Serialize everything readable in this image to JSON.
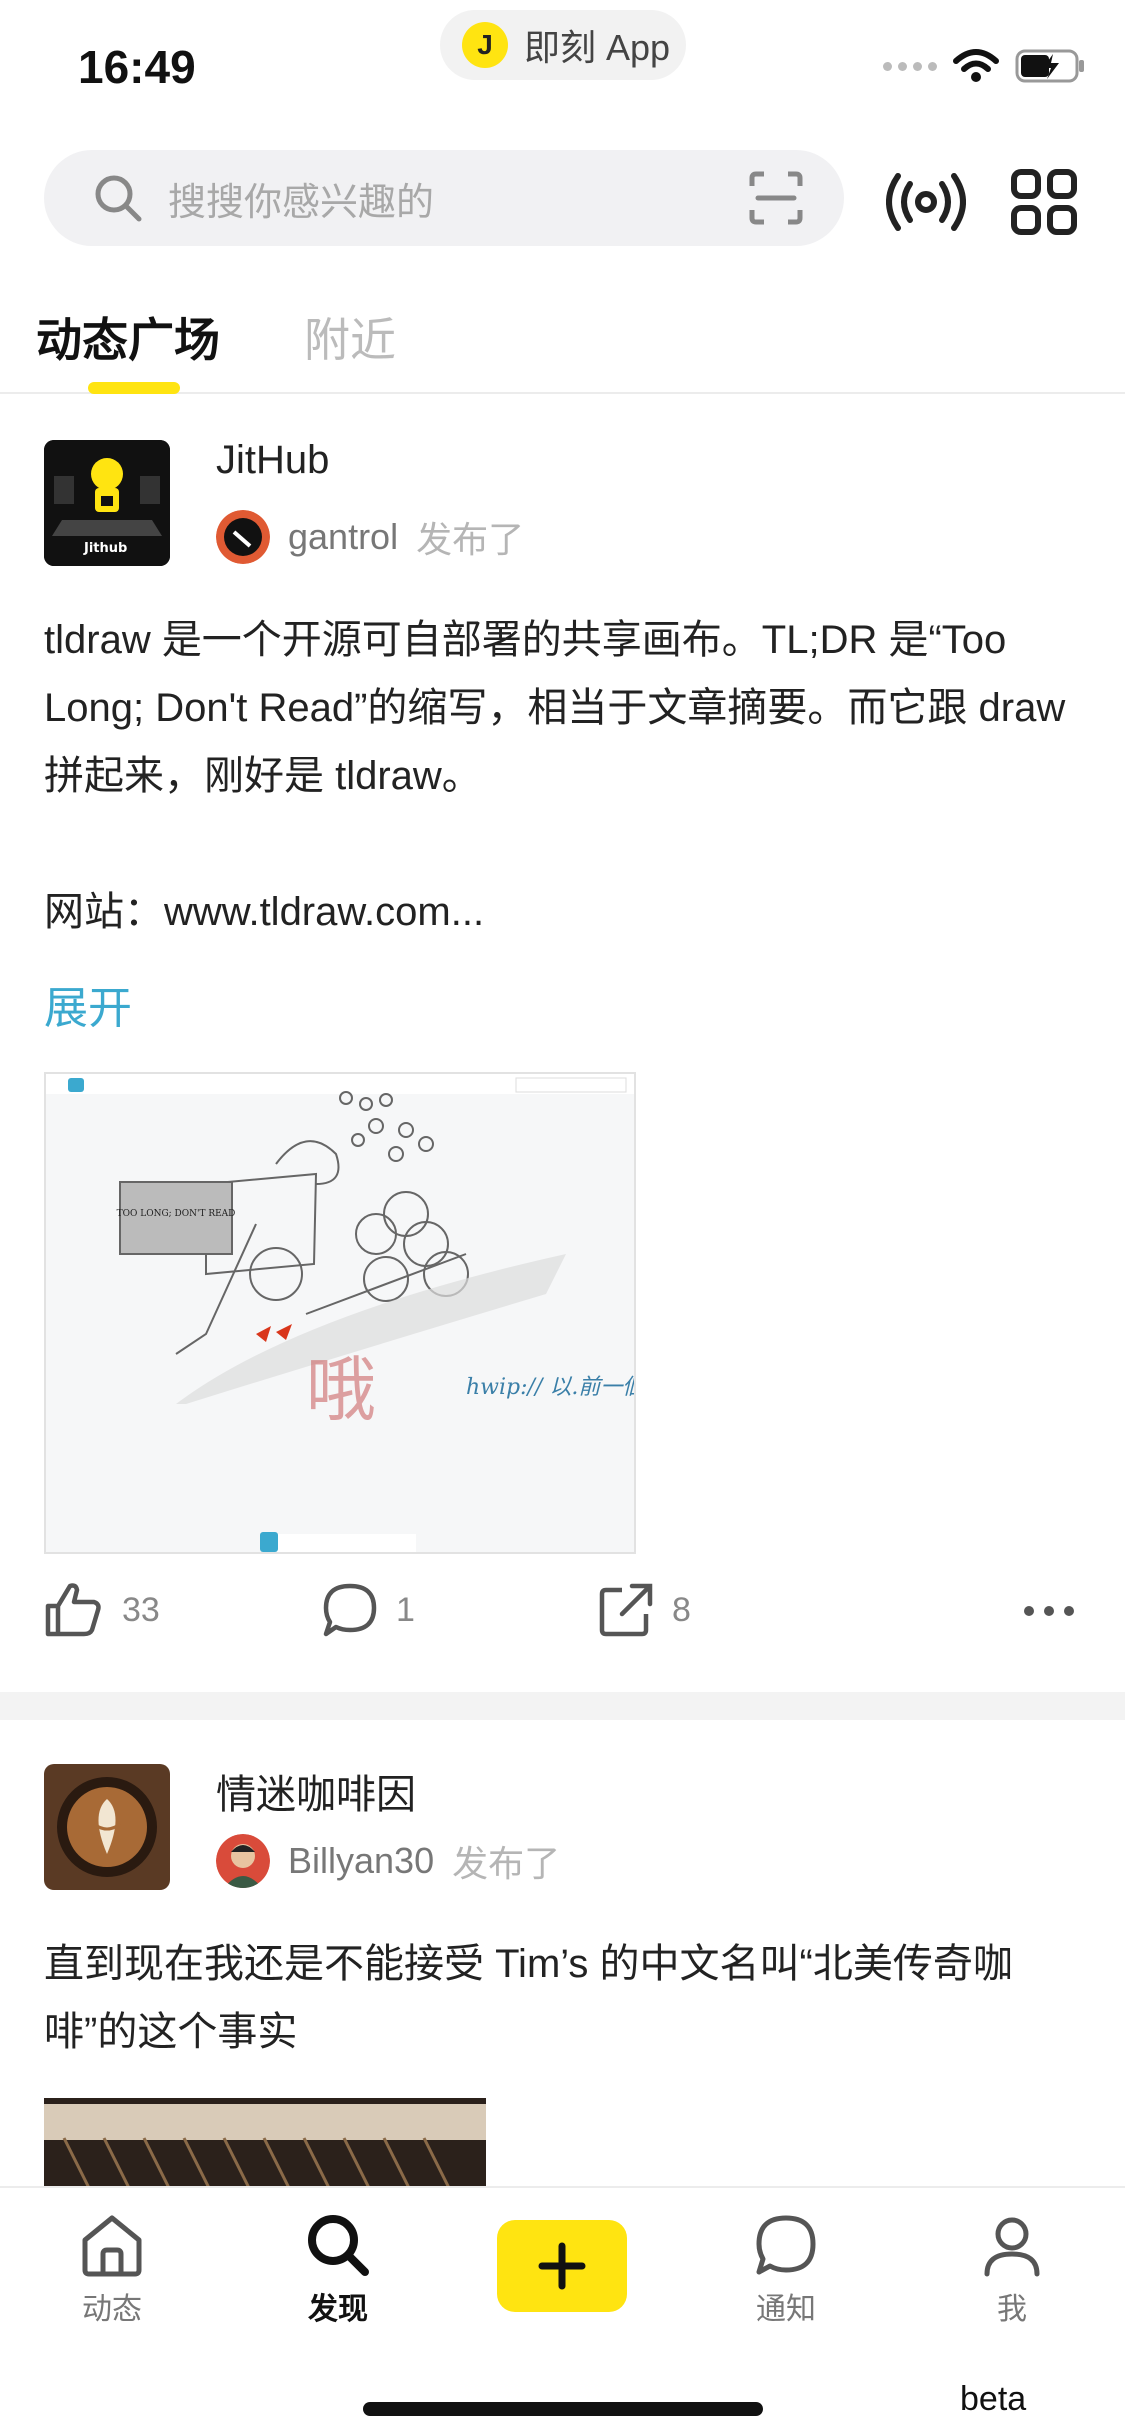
{
  "status_bar": {
    "time": "16:49",
    "app_name": "即刻 App",
    "app_logo_char": "J"
  },
  "search": {
    "placeholder": "搜搜你感兴趣的"
  },
  "tabs": [
    {
      "label": "动态广场",
      "active": true
    },
    {
      "label": "附近",
      "active": false
    }
  ],
  "posts": [
    {
      "topic": "JitHub",
      "author": "gantrol",
      "verb": "发布了",
      "text": "tldraw 是一个开源可自部署的共享画布。TL;DR 是“Too Long; Don't Read”的缩写，相当于文章摘要。而它跟 draw 拼起来，刚好是 tldraw。\n\n网站：www.tldraw.com...",
      "expand_label": "展开",
      "image_caption": "TOO LONG; DON'T READ",
      "image_scribble": "hwip:// 以.前一個",
      "likes": "33",
      "comments": "1",
      "shares": "8"
    },
    {
      "topic": "情迷咖啡因",
      "author": "Billyan30",
      "verb": "发布了",
      "text": "直到现在我还是不能接受 Tim’s 的中文名叫“北美传奇咖啡”的这个事实"
    }
  ],
  "bottom_nav": [
    {
      "label": "动态",
      "icon": "home-icon",
      "active": false
    },
    {
      "label": "发现",
      "icon": "search-icon",
      "active": true
    },
    {
      "label": "通知",
      "icon": "chat-bubble-icon",
      "active": false
    },
    {
      "label": "我",
      "icon": "profile-icon",
      "active": false
    }
  ],
  "badge": "beta",
  "colors": {
    "brand_yellow": "#ffe411",
    "link_blue": "#3ba9cf"
  }
}
